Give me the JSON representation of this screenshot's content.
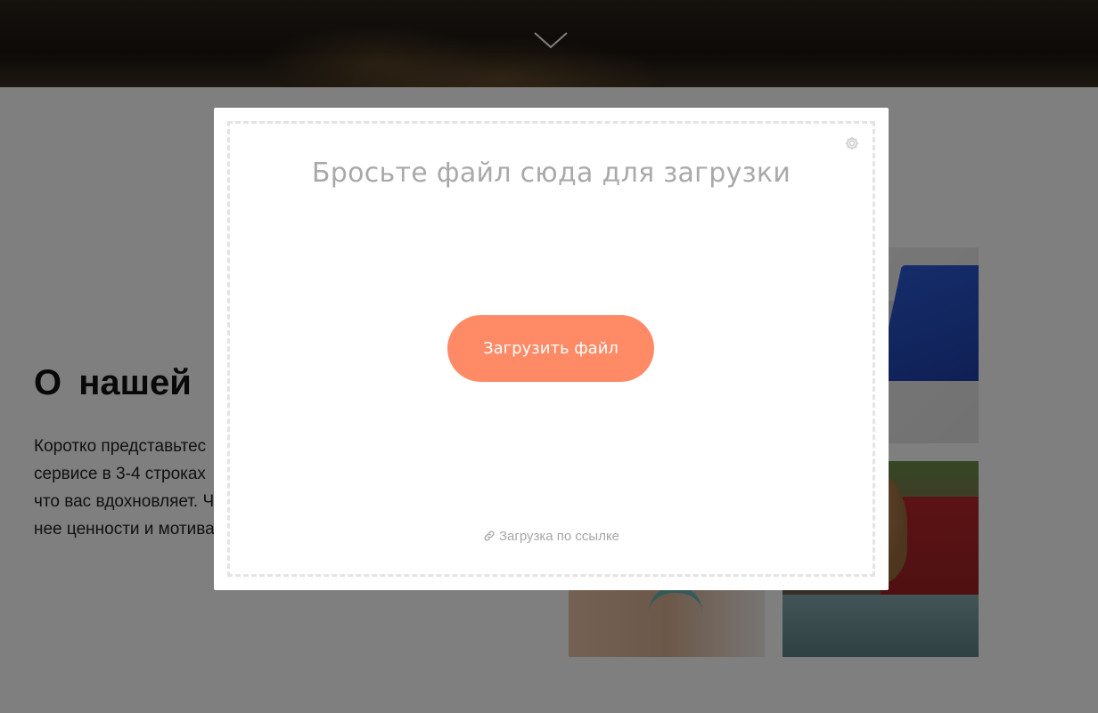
{
  "hero": {
    "chevron_icon": "chevron-down-icon"
  },
  "about": {
    "title": "О нашей",
    "text_lines": [
      "Коротко представьтес",
      "сервисе в 3-4 строках",
      "что вас вдохновляет. Ч",
      "нее ценности и мотива"
    ]
  },
  "upload_dialog": {
    "drop_title": "Бросьте файл сюда для загрузки",
    "upload_button_label": "Загрузить файл",
    "link_upload_label": "Загрузка по ссылке",
    "settings_icon": "gear-icon",
    "link_icon": "link-icon"
  },
  "colors": {
    "accent": "#ff8a65",
    "overlay": "rgba(0,0,0,0.5)",
    "muted_text": "#a9a9a9",
    "dropzone_border": "#e4e4e4"
  }
}
